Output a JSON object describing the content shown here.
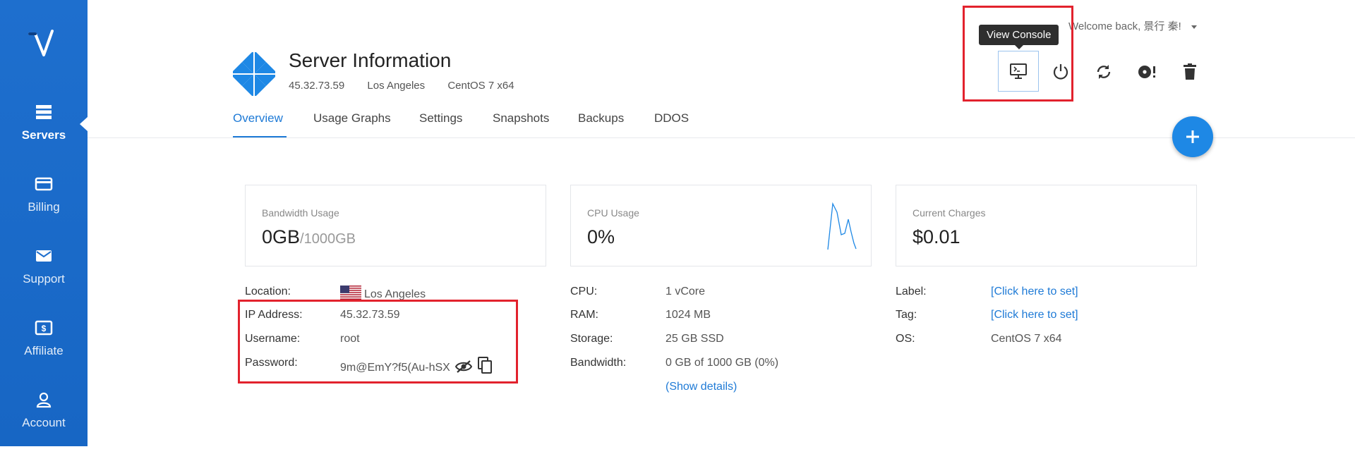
{
  "sidebar": {
    "items": [
      {
        "label": "Servers",
        "icon": "servers-icon"
      },
      {
        "label": "Billing",
        "icon": "billing-icon"
      },
      {
        "label": "Support",
        "icon": "support-icon"
      },
      {
        "label": "Affiliate",
        "icon": "affiliate-icon"
      },
      {
        "label": "Account",
        "icon": "account-icon"
      }
    ],
    "active": "Servers"
  },
  "header": {
    "title": "Server Information",
    "ip": "45.32.73.59",
    "location": "Los Angeles",
    "os": "CentOS 7 x64",
    "welcome": "Welcome back, 景行 秦!"
  },
  "tooltip": "View Console",
  "tabs": [
    "Overview",
    "Usage Graphs",
    "Settings",
    "Snapshots",
    "Backups",
    "DDOS"
  ],
  "active_tab": "Overview",
  "cards": {
    "bandwidth": {
      "label": "Bandwidth Usage",
      "value": "0GB",
      "limit": "/1000GB"
    },
    "cpu": {
      "label": "CPU Usage",
      "value": "0%"
    },
    "charges": {
      "label": "Current Charges",
      "value": "$0.01"
    }
  },
  "details_left": {
    "location_label": "Location:",
    "location": "Los Angeles",
    "ip_label": "IP Address:",
    "ip": "45.32.73.59",
    "username_label": "Username:",
    "username": "root",
    "password_label": "Password:",
    "password": "9m@EmY?f5(Au-hSX"
  },
  "details_mid": {
    "cpu_label": "CPU:",
    "cpu": "1 vCore",
    "ram_label": "RAM:",
    "ram": "1024 MB",
    "storage_label": "Storage:",
    "storage": "25 GB SSD",
    "bandwidth_label": "Bandwidth:",
    "bandwidth": "0 GB of 1000 GB (0%)",
    "show_details": "(Show details)"
  },
  "details_right": {
    "label_label": "Label:",
    "label": "[Click here to set]",
    "tag_label": "Tag:",
    "tag": "[Click here to set]",
    "os_label": "OS:",
    "os": "CentOS 7 x64"
  },
  "colors": {
    "sidebar": "#1e6fce",
    "accent": "#1e7ad6",
    "highlight": "#e2222d"
  }
}
